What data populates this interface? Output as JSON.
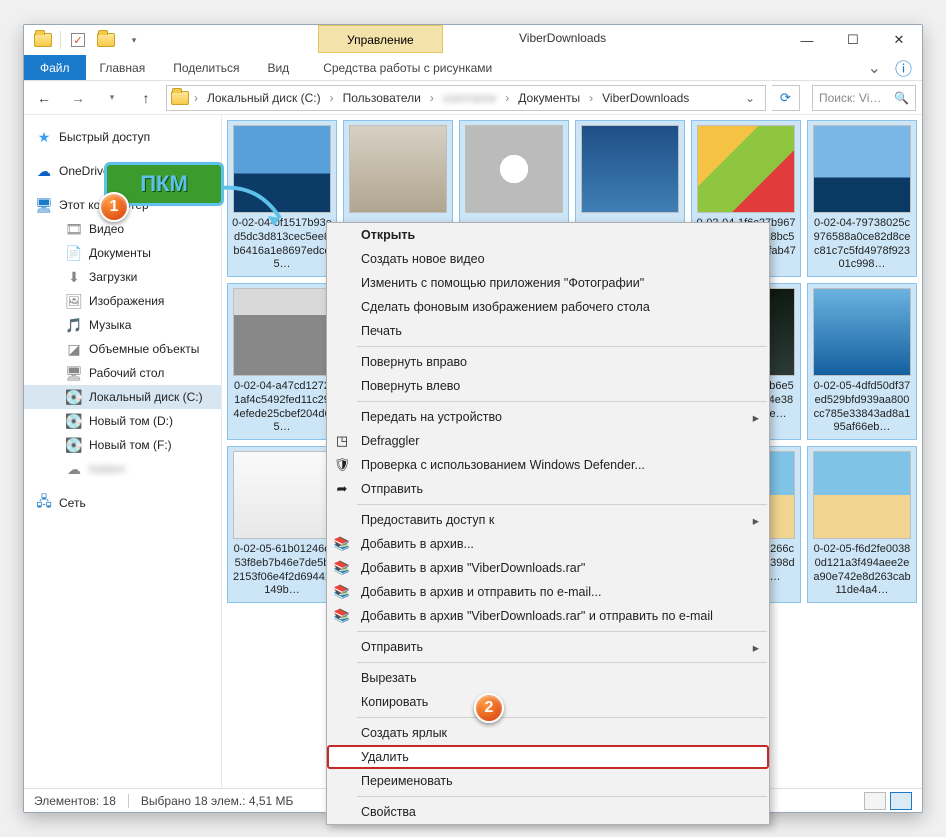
{
  "window": {
    "title": "ViberDownloads",
    "contextual_tab_group": "Управление",
    "contextual_tab": "Средства работы с рисунками"
  },
  "ribbon": {
    "file": "Файл",
    "tabs": [
      "Главная",
      "Поделиться",
      "Вид"
    ]
  },
  "breadcrumb": {
    "items": [
      "Локальный диск (C:)",
      "Пользователи",
      "",
      "Документы",
      "ViberDownloads"
    ],
    "blurred_index": 2
  },
  "search": {
    "placeholder": "Поиск: Vi…"
  },
  "nav": {
    "quick_access": "Быстрый доступ",
    "onedrive": "OneDrive",
    "this_pc": "Этот компьютер",
    "this_pc_children": [
      {
        "label": "Видео",
        "icon": "🎞"
      },
      {
        "label": "Документы",
        "icon": "📄"
      },
      {
        "label": "Загрузки",
        "icon": "⬇"
      },
      {
        "label": "Изображения",
        "icon": "🖼"
      },
      {
        "label": "Музыка",
        "icon": "🎵"
      },
      {
        "label": "Объемные объекты",
        "icon": "◪"
      },
      {
        "label": "Рабочий стол",
        "icon": "🖥"
      },
      {
        "label": "Локальный диск (C:)",
        "icon": "💽",
        "selected": true
      },
      {
        "label": "Новый том (D:)",
        "icon": "💽"
      },
      {
        "label": "Новый том (F:)",
        "icon": "💽"
      },
      {
        "label": "",
        "icon": "☁",
        "blur": true
      }
    ],
    "network": "Сеть"
  },
  "files": [
    {
      "name": "0-02-04-0f1517b93ed5dc3d813cec5ee8b6416a1e8697edce5…",
      "cls": "t1"
    },
    {
      "name": "0-02-04-1f6c27b9676588a0ce821a8bc5a1c5ecd47db3fab47bffe…",
      "cls": "t4"
    },
    {
      "name": "0-02-04-79738025c976588a0ce82d8cec81c7c5fd4978f92301c998…",
      "cls": "t5"
    },
    {
      "name": "0-02-04-a47cd12721af4c5492fed11c294efede25cbef204d65…",
      "cls": "t7"
    },
    {
      "name": "0-02-04-bc86cb6e5b1c902e7a4ef4e3807371ed9f76e…",
      "cls": "t8"
    },
    {
      "name": "0-02-05-4dfd50df37ed529bfd939aa800cc785e33843ad8a195af66eb…",
      "cls": "t9"
    },
    {
      "name": "0-02-05-61b01246e53f8eb7b46e7de5b2153f06e4f2d69441149b…",
      "cls": "t11"
    },
    {
      "name": "0-02-05-e3d17266cd81309097d8c398d7d827f68a7…",
      "cls": "t12"
    },
    {
      "name": "0-02-05-f6d2fe00380d121a3f494aee2ea90e742e8d263cab11de4a4…",
      "cls": "t12"
    }
  ],
  "hidden_thumbs": [
    "t2",
    "t3",
    "t6",
    "t10"
  ],
  "context_menu": {
    "open": "Открыть",
    "new_video": "Создать новое видео",
    "edit_photos": "Изменить с помощью приложения \"Фотографии\"",
    "set_wallpaper": "Сделать фоновым изображением рабочего стола",
    "print": "Печать",
    "rotate_right": "Повернуть вправо",
    "rotate_left": "Повернуть влево",
    "cast": "Передать на устройство",
    "defraggler": "Defraggler",
    "defender": "Проверка с использованием Windows Defender...",
    "share": "Отправить",
    "grant_access": "Предоставить доступ к",
    "rar_add": "Добавить в архив...",
    "rar_add_named": "Добавить в архив \"ViberDownloads.rar\"",
    "rar_email": "Добавить в архив и отправить по e-mail...",
    "rar_email_named": "Добавить в архив \"ViberDownloads.rar\" и отправить по e-mail",
    "send_to": "Отправить",
    "cut": "Вырезать",
    "copy": "Копировать",
    "shortcut": "Создать ярлык",
    "delete": "Удалить",
    "rename": "Переименовать",
    "properties": "Свойства"
  },
  "status": {
    "items": "Элементов: 18",
    "selected": "Выбрано 18 элем.: 4,51 МБ"
  },
  "annotations": {
    "pkm": "ПКМ",
    "badge1": "1",
    "badge2": "2"
  }
}
